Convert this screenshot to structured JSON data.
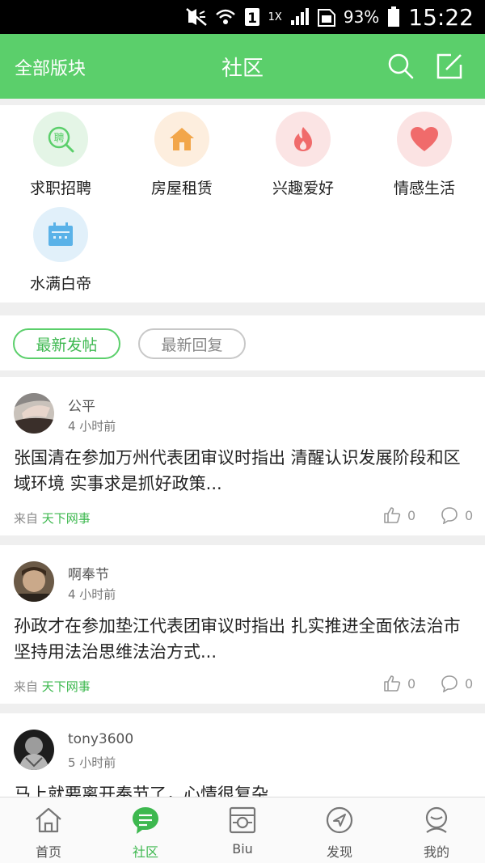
{
  "status_bar": {
    "battery": "93%",
    "time": "15:22",
    "network": "1X"
  },
  "app_bar": {
    "left_label": "全部版块",
    "title": "社区"
  },
  "categories": [
    {
      "label": "求职招聘",
      "icon": "job-search-icon",
      "bg": "#e4f5e6",
      "color": "#5bcf6b",
      "glyph": "聘"
    },
    {
      "label": "房屋租赁",
      "icon": "house-icon",
      "bg": "#fdeede",
      "color": "#f2a64a"
    },
    {
      "label": "兴趣爱好",
      "icon": "flame-icon",
      "bg": "#fbe4e4",
      "color": "#f06b6b"
    },
    {
      "label": "情感生活",
      "icon": "heart-icon",
      "bg": "#fbe3e3",
      "color": "#f06b6b"
    },
    {
      "label": "水满白帝",
      "icon": "calendar-icon",
      "bg": "#e1f0fa",
      "color": "#5ab2e8"
    }
  ],
  "tabs": {
    "latest_posts": "最新发帖",
    "latest_replies": "最新回复"
  },
  "posts": [
    {
      "user": "公平",
      "time": "4 小时前",
      "text": "张国清在参加万州代表团审议时指出 清醒认识发展阶段和区域环境 实事求是抓好政策...",
      "source_prefix": "来自",
      "source": "天下网事",
      "likes": "0",
      "comments": "0"
    },
    {
      "user": "啊奉节",
      "time": "4 小时前",
      "text": "孙政才在参加垫江代表团审议时指出 扎实推进全面依法治市 坚持用法治思维法治方式...",
      "source_prefix": "来自",
      "source": "天下网事",
      "likes": "0",
      "comments": "0"
    },
    {
      "user": "tony3600",
      "time": "5 小时前",
      "text": "马上就要离开奉节了，心情很复杂",
      "source_prefix": "",
      "source": "",
      "likes": "",
      "comments": ""
    }
  ],
  "bottom_nav": [
    {
      "label": "首页",
      "icon": "home-icon"
    },
    {
      "label": "社区",
      "icon": "community-chat-icon"
    },
    {
      "label": "Biu",
      "icon": "camera-icon"
    },
    {
      "label": "发现",
      "icon": "compass-icon"
    },
    {
      "label": "我的",
      "icon": "profile-icon"
    }
  ],
  "colors": {
    "accent": "#5bcf6b",
    "accent_text": "#3db84f",
    "status_bar": "#000000"
  }
}
